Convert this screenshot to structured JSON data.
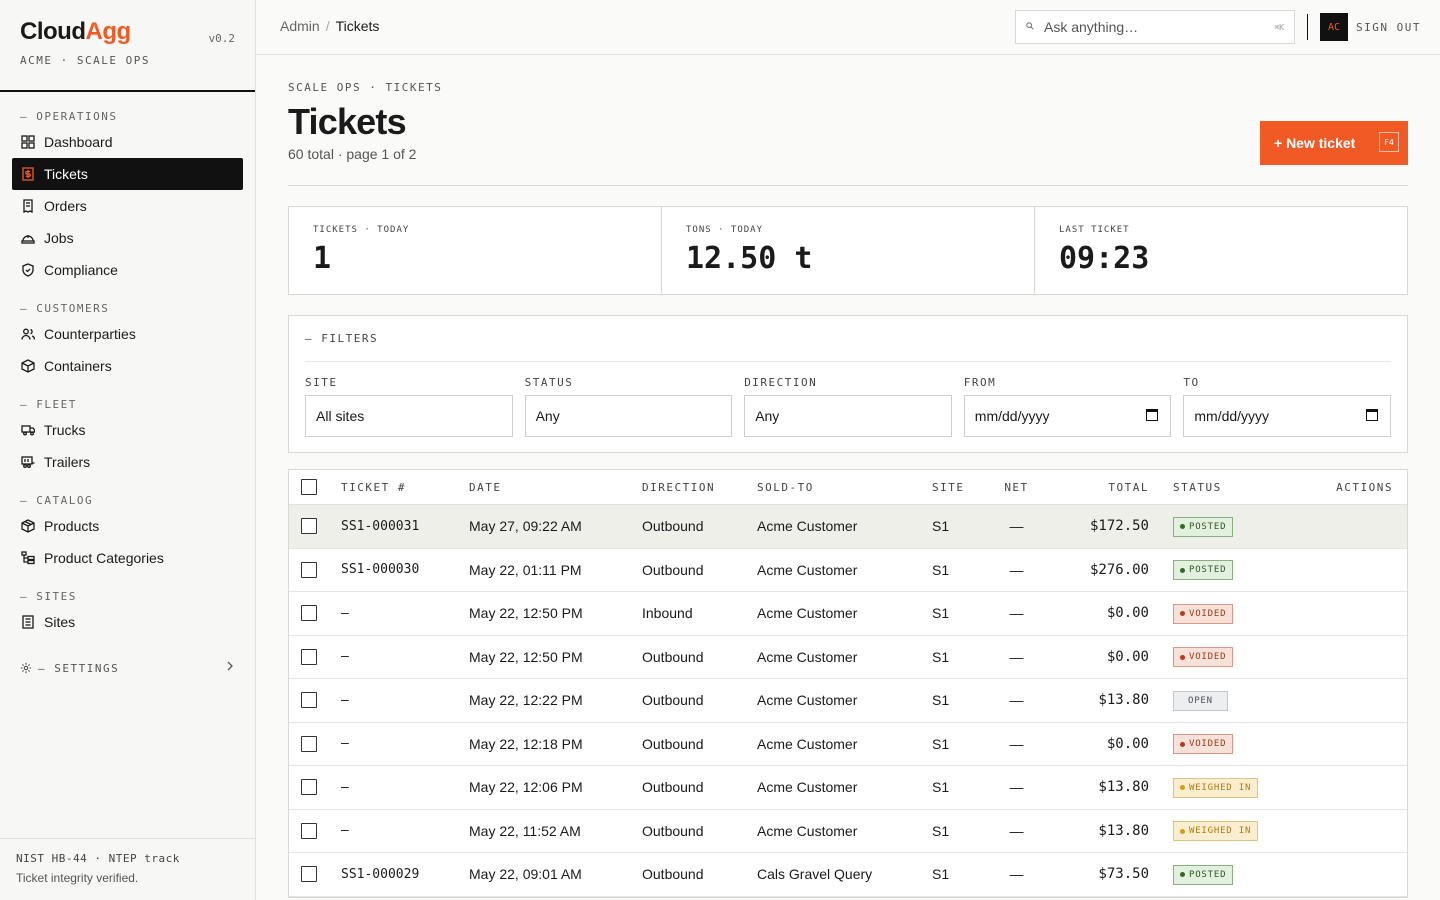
{
  "brand": {
    "name_a": "Cloud",
    "name_b": "Agg",
    "version": "v0.2",
    "org": "ACME · SCALE OPS"
  },
  "nav": {
    "sections": [
      {
        "label": "— OPERATIONS",
        "items": [
          {
            "label": "Dashboard",
            "icon": "grid-icon"
          },
          {
            "label": "Tickets",
            "icon": "ticket-icon",
            "active": true
          },
          {
            "label": "Orders",
            "icon": "receipt-icon"
          },
          {
            "label": "Jobs",
            "icon": "hardhat-icon"
          },
          {
            "label": "Compliance",
            "icon": "shield-icon"
          }
        ]
      },
      {
        "label": "— CUSTOMERS",
        "items": [
          {
            "label": "Counterparties",
            "icon": "users-icon"
          },
          {
            "label": "Containers",
            "icon": "box-icon"
          }
        ]
      },
      {
        "label": "— FLEET",
        "items": [
          {
            "label": "Trucks",
            "icon": "truck-icon"
          },
          {
            "label": "Trailers",
            "icon": "trailer-icon"
          }
        ]
      },
      {
        "label": "— CATALOG",
        "items": [
          {
            "label": "Products",
            "icon": "package-icon"
          },
          {
            "label": "Product Categories",
            "icon": "tree-icon"
          }
        ]
      },
      {
        "label": "— SITES",
        "items": [
          {
            "label": "Sites",
            "icon": "building-icon"
          }
        ]
      }
    ],
    "settings": "— SETTINGS"
  },
  "footer": {
    "line1": "NIST HB-44 · NTEP track",
    "line2": "Ticket integrity verified."
  },
  "topbar": {
    "crumb_root": "Admin",
    "crumb_sep": "/",
    "crumb_current": "Tickets",
    "search_placeholder": "Ask anything…",
    "search_kbd": "⌘K",
    "avatar": "AC",
    "signout": "SIGN OUT"
  },
  "page": {
    "eyebrow": "SCALE OPS · TICKETS",
    "title": "Tickets",
    "subtitle": "60 total · page 1 of 2",
    "new_button": "+ New ticket",
    "new_kbd": "F4"
  },
  "stats": [
    {
      "label": "TICKETS · TODAY",
      "value": "1"
    },
    {
      "label": "TONS · TODAY",
      "value": "12.50 t"
    },
    {
      "label": "LAST TICKET",
      "value": "09:23"
    }
  ],
  "filters": {
    "heading": "— FILTERS",
    "fields": [
      {
        "label": "SITE",
        "value": "All sites"
      },
      {
        "label": "STATUS",
        "value": "Any"
      },
      {
        "label": "DIRECTION",
        "value": "Any"
      },
      {
        "label": "FROM",
        "value": "mm/dd/yyyy"
      },
      {
        "label": "TO",
        "value": "mm/dd/yyyy"
      }
    ]
  },
  "table": {
    "columns": [
      "TICKET #",
      "DATE",
      "DIRECTION",
      "SOLD-TO",
      "SITE",
      "NET",
      "TOTAL",
      "STATUS",
      "ACTIONS"
    ],
    "rows": [
      {
        "ticket": "SS1-000031",
        "date": "May 27, 09:22 AM",
        "direction": "Outbound",
        "sold_to": "Acme Customer",
        "site": "S1",
        "net": "—",
        "total": "$172.50",
        "status": "POSTED",
        "kind": "posted"
      },
      {
        "ticket": "SS1-000030",
        "date": "May 22, 01:11 PM",
        "direction": "Outbound",
        "sold_to": "Acme Customer",
        "site": "S1",
        "net": "—",
        "total": "$276.00",
        "status": "POSTED",
        "kind": "posted"
      },
      {
        "ticket": "–",
        "date": "May 22, 12:50 PM",
        "direction": "Inbound",
        "sold_to": "Acme Customer",
        "site": "S1",
        "net": "—",
        "total": "$0.00",
        "status": "VOIDED",
        "kind": "voided"
      },
      {
        "ticket": "–",
        "date": "May 22, 12:50 PM",
        "direction": "Outbound",
        "sold_to": "Acme Customer",
        "site": "S1",
        "net": "—",
        "total": "$0.00",
        "status": "VOIDED",
        "kind": "voided"
      },
      {
        "ticket": "–",
        "date": "May 22, 12:22 PM",
        "direction": "Outbound",
        "sold_to": "Acme Customer",
        "site": "S1",
        "net": "—",
        "total": "$13.80",
        "status": "OPEN",
        "kind": "open"
      },
      {
        "ticket": "–",
        "date": "May 22, 12:18 PM",
        "direction": "Outbound",
        "sold_to": "Acme Customer",
        "site": "S1",
        "net": "—",
        "total": "$0.00",
        "status": "VOIDED",
        "kind": "voided"
      },
      {
        "ticket": "–",
        "date": "May 22, 12:06 PM",
        "direction": "Outbound",
        "sold_to": "Acme Customer",
        "site": "S1",
        "net": "—",
        "total": "$13.80",
        "status": "WEIGHED IN",
        "kind": "weighed"
      },
      {
        "ticket": "–",
        "date": "May 22, 11:52 AM",
        "direction": "Outbound",
        "sold_to": "Acme Customer",
        "site": "S1",
        "net": "—",
        "total": "$13.80",
        "status": "WEIGHED IN",
        "kind": "weighed"
      },
      {
        "ticket": "SS1-000029",
        "date": "May 22, 09:01 AM",
        "direction": "Outbound",
        "sold_to": "Cals Gravel Query",
        "site": "S1",
        "net": "—",
        "total": "$73.50",
        "status": "POSTED",
        "kind": "posted"
      }
    ]
  },
  "colors": {
    "accent": "#f15a24",
    "ink": "#111111",
    "posted": "#2f6b22",
    "voided": "#b8391a",
    "weighed": "#d99a12"
  }
}
